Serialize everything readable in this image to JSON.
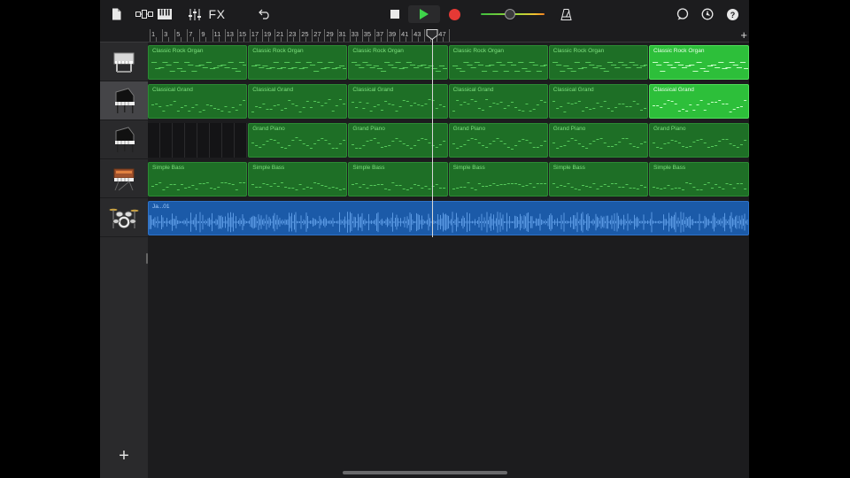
{
  "toolbar": {
    "fx_label": "FX",
    "icons": [
      "document-icon",
      "tracks-view-icon",
      "keyboard-icon",
      "mixer-icon",
      "undo-icon",
      "metronome-icon",
      "loop-browser-icon",
      "settings-icon",
      "help-icon"
    ],
    "accent": "#3fbf3f",
    "record_color": "#e53935",
    "play_color": "#3fd44a"
  },
  "ruler": {
    "bar_numbers": [
      "1",
      "3",
      "5",
      "7",
      "9",
      "11",
      "13",
      "15",
      "17",
      "19",
      "21",
      "23",
      "25",
      "27",
      "29",
      "31",
      "33",
      "35",
      "37",
      "39",
      "41",
      "43",
      "45",
      "47"
    ],
    "add_section_label": "+"
  },
  "tracks": [
    {
      "name": "Classic Rock Organ",
      "instrument_icon": "organ-icon",
      "selected": false,
      "regions": [
        "Classic Rock Organ",
        "Classic Rock Organ",
        "Classic Rock Organ",
        "Classic Rock Organ",
        "Classic Rock Organ",
        "Classic Rock Organ"
      ],
      "highlighted_region": 5
    },
    {
      "name": "Classical Grand",
      "instrument_icon": "grand-piano-icon",
      "selected": true,
      "regions": [
        "Classical Grand",
        "Classical Grand",
        "Classical Grand",
        "Classical Grand",
        "Classical Grand",
        "Classical Grand"
      ],
      "highlighted_region": 5
    },
    {
      "name": "Grand Piano",
      "instrument_icon": "grand-piano-icon",
      "selected": false,
      "regions": [
        "",
        "Grand Piano",
        "Grand Piano",
        "Grand Piano",
        "Grand Piano",
        "Grand Piano"
      ],
      "highlighted_region": -1
    },
    {
      "name": "Simple Bass",
      "instrument_icon": "synth-keyboard-icon",
      "selected": false,
      "regions": [
        "Simple Bass",
        "Simple Bass",
        "Simple Bass",
        "Simple Bass",
        "Simple Bass",
        "Simple Bass"
      ],
      "highlighted_region": -1
    },
    {
      "name": "Ja...01",
      "instrument_icon": "drum-kit-icon",
      "selected": false,
      "audio_region_label": "Ja...01"
    }
  ],
  "colors": {
    "region_green": "#1e6f26",
    "region_highlight": "#2dbf3a",
    "audio_blue": "#1b5aa8",
    "background": "#1c1c1e"
  },
  "add_track_label": "+"
}
